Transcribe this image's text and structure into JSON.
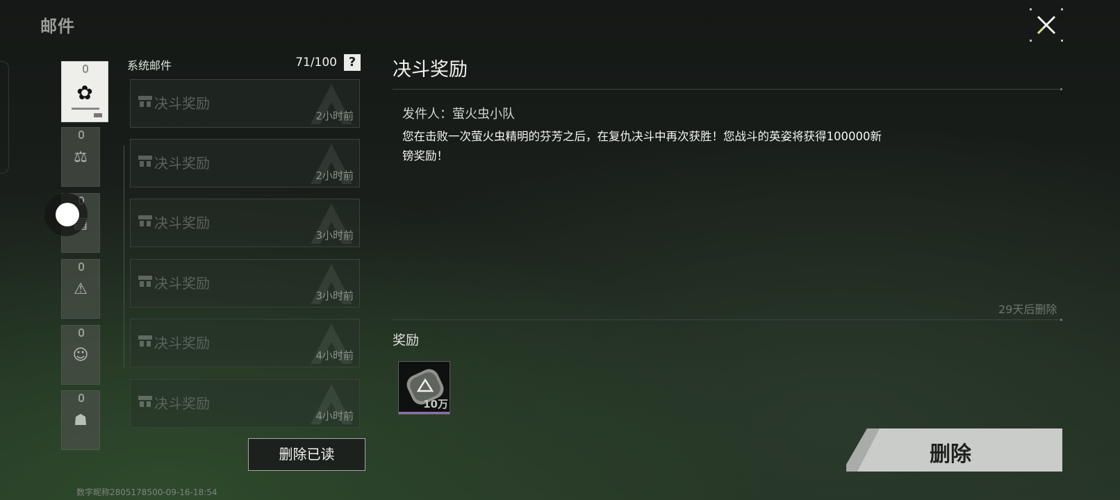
{
  "header": {
    "title": "邮件"
  },
  "categories": [
    {
      "icon": "flower-icon",
      "glyph": "✿",
      "active": true
    },
    {
      "icon": "gavel-icon",
      "glyph": "⚖",
      "active": false
    },
    {
      "icon": "notice-board-icon",
      "glyph": "▤",
      "active": false
    },
    {
      "icon": "warning-icon",
      "glyph": "⚠",
      "active": false
    },
    {
      "icon": "face-icon",
      "glyph": "☺",
      "active": false
    },
    {
      "icon": "robot-icon",
      "glyph": "☗",
      "active": false
    }
  ],
  "mail_list": {
    "title": "系统邮件",
    "count": "71/100",
    "help": "?",
    "items": [
      {
        "title": "决斗奖励",
        "time": "2小时前"
      },
      {
        "title": "决斗奖励",
        "time": "2小时前"
      },
      {
        "title": "决斗奖励",
        "time": "3小时前"
      },
      {
        "title": "决斗奖励",
        "time": "3小时前"
      },
      {
        "title": "决斗奖励",
        "time": "4小时前"
      },
      {
        "title": "决斗奖励",
        "time": "4小时前"
      }
    ],
    "delete_read_label": "删除已读"
  },
  "footer": {
    "id_text": "数字昵称2805178500-09-16-18:54"
  },
  "detail": {
    "title": "决斗奖励",
    "sender": "发件人：萤火虫小队",
    "body": "您在击败一次萤火虫精明的芬芳之后，在复仇决斗中再次获胜！您战斗的英姿将获得100000新镑奖励！",
    "expire": "29天后删除",
    "reward_label": "奖励",
    "reward": {
      "icon": "currency-icon",
      "quantity": "10万"
    },
    "delete_label": "删除"
  },
  "colors": {
    "accent_purple": "#8e6fa8",
    "close_accent": "#c8e08a"
  }
}
